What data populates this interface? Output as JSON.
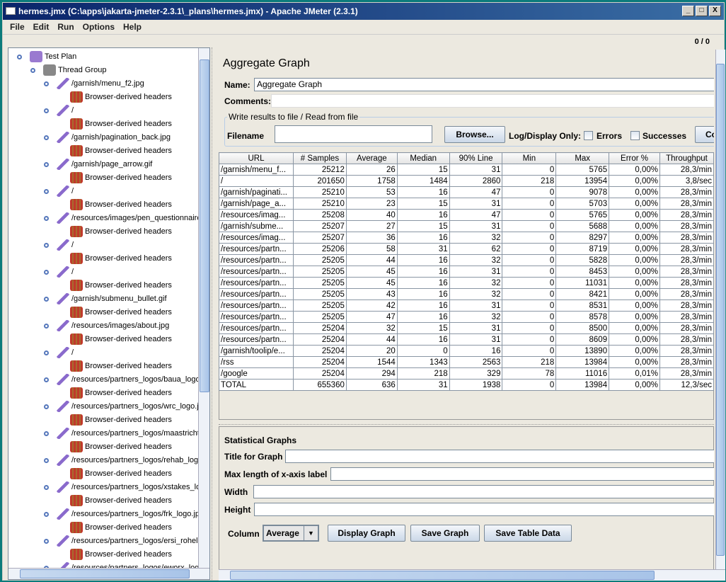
{
  "window": {
    "title": "hermes.jmx (C:\\apps\\jakarta-jmeter-2.3.1\\_plans\\hermes.jmx) - Apache JMeter (2.3.1)",
    "controls": [
      "_",
      "□",
      "X"
    ]
  },
  "menu": [
    "File",
    "Edit",
    "Run",
    "Options",
    "Help"
  ],
  "toolbar": {
    "counter": "0 / 0"
  },
  "tree": [
    {
      "label": "Test Plan",
      "level": 0,
      "icon": "test-plan-flask-icon"
    },
    {
      "label": "Thread Group",
      "level": 1,
      "icon": "thread-group-spool-icon"
    },
    {
      "label": "/garnish/menu_f2.jpg",
      "level": 2,
      "icon": "sampler-pipette-icon"
    },
    {
      "label": "Browser-derived headers",
      "level": 3,
      "icon": "header-manager-icon"
    },
    {
      "label": "/",
      "level": 2,
      "icon": "sampler-pipette-icon"
    },
    {
      "label": "Browser-derived headers",
      "level": 3,
      "icon": "header-manager-icon"
    },
    {
      "label": "/garnish/pagination_back.jpg",
      "level": 2,
      "icon": "sampler-pipette-icon"
    },
    {
      "label": "Browser-derived headers",
      "level": 3,
      "icon": "header-manager-icon"
    },
    {
      "label": "/garnish/page_arrow.gif",
      "level": 2,
      "icon": "sampler-pipette-icon"
    },
    {
      "label": "Browser-derived headers",
      "level": 3,
      "icon": "header-manager-icon"
    },
    {
      "label": "/",
      "level": 2,
      "icon": "sampler-pipette-icon"
    },
    {
      "label": "Browser-derived headers",
      "level": 3,
      "icon": "header-manager-icon"
    },
    {
      "label": "/resources/images/pen_questionnaire.",
      "level": 2,
      "icon": "sampler-pipette-icon"
    },
    {
      "label": "Browser-derived headers",
      "level": 3,
      "icon": "header-manager-icon"
    },
    {
      "label": "/",
      "level": 2,
      "icon": "sampler-pipette-icon"
    },
    {
      "label": "Browser-derived headers",
      "level": 3,
      "icon": "header-manager-icon"
    },
    {
      "label": "/",
      "level": 2,
      "icon": "sampler-pipette-icon"
    },
    {
      "label": "Browser-derived headers",
      "level": 3,
      "icon": "header-manager-icon"
    },
    {
      "label": "/garnish/submenu_bullet.gif",
      "level": 2,
      "icon": "sampler-pipette-icon"
    },
    {
      "label": "Browser-derived headers",
      "level": 3,
      "icon": "header-manager-icon"
    },
    {
      "label": "/resources/images/about.jpg",
      "level": 2,
      "icon": "sampler-pipette-icon"
    },
    {
      "label": "Browser-derived headers",
      "level": 3,
      "icon": "header-manager-icon"
    },
    {
      "label": "/",
      "level": 2,
      "icon": "sampler-pipette-icon"
    },
    {
      "label": "Browser-derived headers",
      "level": 3,
      "icon": "header-manager-icon"
    },
    {
      "label": "/resources/partners_logos/baua_logo.",
      "level": 2,
      "icon": "sampler-pipette-icon"
    },
    {
      "label": "Browser-derived headers",
      "level": 3,
      "icon": "header-manager-icon"
    },
    {
      "label": "/resources/partners_logos/wrc_logo.jp",
      "level": 2,
      "icon": "sampler-pipette-icon"
    },
    {
      "label": "Browser-derived headers",
      "level": 3,
      "icon": "header-manager-icon"
    },
    {
      "label": "/resources/partners_logos/maastricht_",
      "level": 2,
      "icon": "sampler-pipette-icon"
    },
    {
      "label": "Browser-derived headers",
      "level": 3,
      "icon": "header-manager-icon"
    },
    {
      "label": "/resources/partners_logos/rehab_logo",
      "level": 2,
      "icon": "sampler-pipette-icon"
    },
    {
      "label": "Browser-derived headers",
      "level": 3,
      "icon": "header-manager-icon"
    },
    {
      "label": "/resources/partners_logos/xstakes_lo",
      "level": 2,
      "icon": "sampler-pipette-icon"
    },
    {
      "label": "Browser-derived headers",
      "level": 3,
      "icon": "header-manager-icon"
    },
    {
      "label": "/resources/partners_logos/frk_logo.jpg",
      "level": 2,
      "icon": "sampler-pipette-icon"
    },
    {
      "label": "Browser-derived headers",
      "level": 3,
      "icon": "header-manager-icon"
    },
    {
      "label": "/resources/partners_logos/ersi_rohelin",
      "level": 2,
      "icon": "sampler-pipette-icon"
    },
    {
      "label": "Browser-derived headers",
      "level": 3,
      "icon": "header-manager-icon"
    },
    {
      "label": "/resources/partners_logos/eworx_log",
      "level": 2,
      "icon": "sampler-pipette-icon"
    }
  ],
  "panel": {
    "title": "Aggregate Graph",
    "name_label": "Name:",
    "name_value": "Aggregate Graph",
    "comments_label": "Comments:",
    "file_group_title": "Write results to file / Read from file",
    "filename_label": "Filename",
    "filename_value": "",
    "browse_label": "Browse...",
    "log_display_label": "Log/Display Only:",
    "errors_label": "Errors",
    "errors_checked": false,
    "successes_label": "Successes",
    "successes_checked": false,
    "configure_label": "Co"
  },
  "table": {
    "columns": [
      "URL",
      "# Samples",
      "Average",
      "Median",
      "90% Line",
      "Min",
      "Max",
      "Error %",
      "Throughput"
    ],
    "rows": [
      [
        "/garnish/menu_f...",
        "25212",
        "26",
        "15",
        "31",
        "0",
        "5765",
        "0,00%",
        "28,3/min"
      ],
      [
        "/",
        "201650",
        "1758",
        "1484",
        "2860",
        "218",
        "13954",
        "0,00%",
        "3,8/sec"
      ],
      [
        "/garnish/paginati...",
        "25210",
        "53",
        "16",
        "47",
        "0",
        "9078",
        "0,00%",
        "28,3/min"
      ],
      [
        "/garnish/page_a...",
        "25210",
        "23",
        "15",
        "31",
        "0",
        "5703",
        "0,00%",
        "28,3/min"
      ],
      [
        "/resources/imag...",
        "25208",
        "40",
        "16",
        "47",
        "0",
        "5765",
        "0,00%",
        "28,3/min"
      ],
      [
        "/garnish/subme...",
        "25207",
        "27",
        "15",
        "31",
        "0",
        "5688",
        "0,00%",
        "28,3/min"
      ],
      [
        "/resources/imag...",
        "25207",
        "36",
        "16",
        "32",
        "0",
        "8297",
        "0,00%",
        "28,3/min"
      ],
      [
        "/resources/partn...",
        "25206",
        "58",
        "31",
        "62",
        "0",
        "8719",
        "0,00%",
        "28,3/min"
      ],
      [
        "/resources/partn...",
        "25205",
        "44",
        "16",
        "32",
        "0",
        "5828",
        "0,00%",
        "28,3/min"
      ],
      [
        "/resources/partn...",
        "25205",
        "45",
        "16",
        "31",
        "0",
        "8453",
        "0,00%",
        "28,3/min"
      ],
      [
        "/resources/partn...",
        "25205",
        "45",
        "16",
        "32",
        "0",
        "11031",
        "0,00%",
        "28,3/min"
      ],
      [
        "/resources/partn...",
        "25205",
        "43",
        "16",
        "32",
        "0",
        "8421",
        "0,00%",
        "28,3/min"
      ],
      [
        "/resources/partn...",
        "25205",
        "42",
        "16",
        "31",
        "0",
        "8531",
        "0,00%",
        "28,3/min"
      ],
      [
        "/resources/partn...",
        "25205",
        "47",
        "16",
        "32",
        "0",
        "8578",
        "0,00%",
        "28,3/min"
      ],
      [
        "/resources/partn...",
        "25204",
        "32",
        "15",
        "31",
        "0",
        "8500",
        "0,00%",
        "28,3/min"
      ],
      [
        "/resources/partn...",
        "25204",
        "44",
        "16",
        "31",
        "0",
        "8609",
        "0,00%",
        "28,3/min"
      ],
      [
        "/garnish/toolip/e...",
        "25204",
        "20",
        "0",
        "16",
        "0",
        "13890",
        "0,00%",
        "28,3/min"
      ],
      [
        "/rss",
        "25204",
        "1544",
        "1343",
        "2563",
        "218",
        "13984",
        "0,00%",
        "28,3/min"
      ],
      [
        "/google",
        "25204",
        "294",
        "218",
        "329",
        "78",
        "11016",
        "0,01%",
        "28,3/min"
      ],
      [
        "TOTAL",
        "655360",
        "636",
        "31",
        "1938",
        "0",
        "13984",
        "0,00%",
        "12,3/sec"
      ]
    ]
  },
  "graph": {
    "section_title": "Statistical Graphs",
    "title_label": "Title for Graph",
    "title_value": "",
    "maxlen_label": "Max length of x-axis label",
    "maxlen_value": "",
    "width_label": "Width",
    "width_value": "",
    "height_label": "Height",
    "height_value": "",
    "column_label": "Column",
    "column_value": "Average",
    "display_label": "Display Graph",
    "save_graph_label": "Save Graph",
    "save_table_label": "Save Table Data"
  }
}
